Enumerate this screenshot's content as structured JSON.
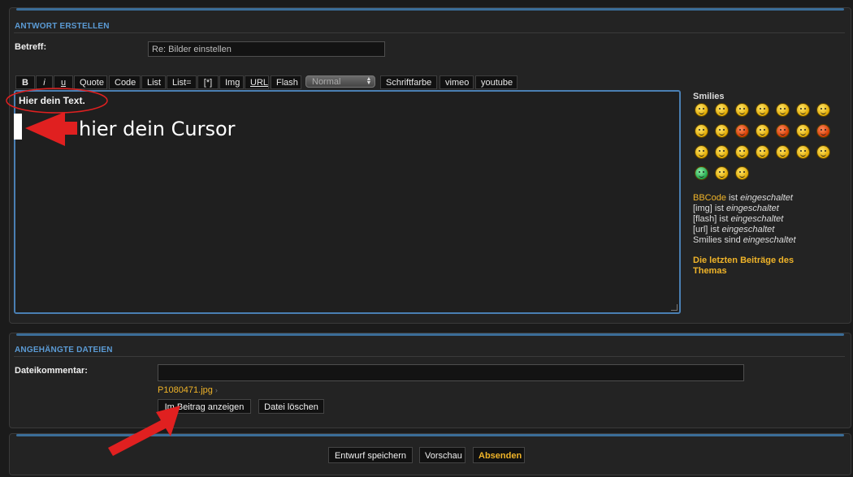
{
  "reply_section": {
    "heading": "ANTWORT ERSTELLEN",
    "subject_label": "Betreff:",
    "subject_value": "Re: Bilder einstellen"
  },
  "toolbar": {
    "bold": "B",
    "italic": "i",
    "underline": "u",
    "quote": "Quote",
    "code": "Code",
    "list": "List",
    "list_item": "List=",
    "bullet": "[*]",
    "img": "Img",
    "url": "URL",
    "flash": "Flash",
    "font_size_selected": "Normal",
    "font_color": "Schriftfarbe",
    "vimeo": "vimeo",
    "youtube": "youtube"
  },
  "editor": {
    "text": "Hier dein Text."
  },
  "annotation": {
    "cursor_label": "hier dein Cursor"
  },
  "sidebar": {
    "smilies_title": "Smilies",
    "smilies_count": 24,
    "status": [
      {
        "name": "BBCode",
        "verb": "ist",
        "state": "eingeschaltet"
      },
      {
        "name": "[img]",
        "verb": "ist",
        "state": "eingeschaltet"
      },
      {
        "name": "[flash]",
        "verb": "ist",
        "state": "eingeschaltet"
      },
      {
        "name": "[url]",
        "verb": "ist",
        "state": "eingeschaltet"
      },
      {
        "name": "Smilies",
        "verb": "sind",
        "state": "eingeschaltet"
      }
    ],
    "latest_posts_link": "Die letzten Beiträge des Themas"
  },
  "attachments": {
    "heading": "ANGEHÄNGTE DATEIEN",
    "comment_label": "Dateikommentar:",
    "comment_value": "",
    "file_name": "P1080471.jpg",
    "show_in_post_button": "Im Beitrag anzeigen",
    "delete_file_button": "Datei löschen"
  },
  "actions": {
    "save_draft": "Entwurf speichern",
    "preview": "Vorschau",
    "submit": "Absenden"
  },
  "colors": {
    "accent_blue": "#5b9bd5",
    "link_orange": "#f0b429",
    "annotation_red": "#e02020"
  }
}
